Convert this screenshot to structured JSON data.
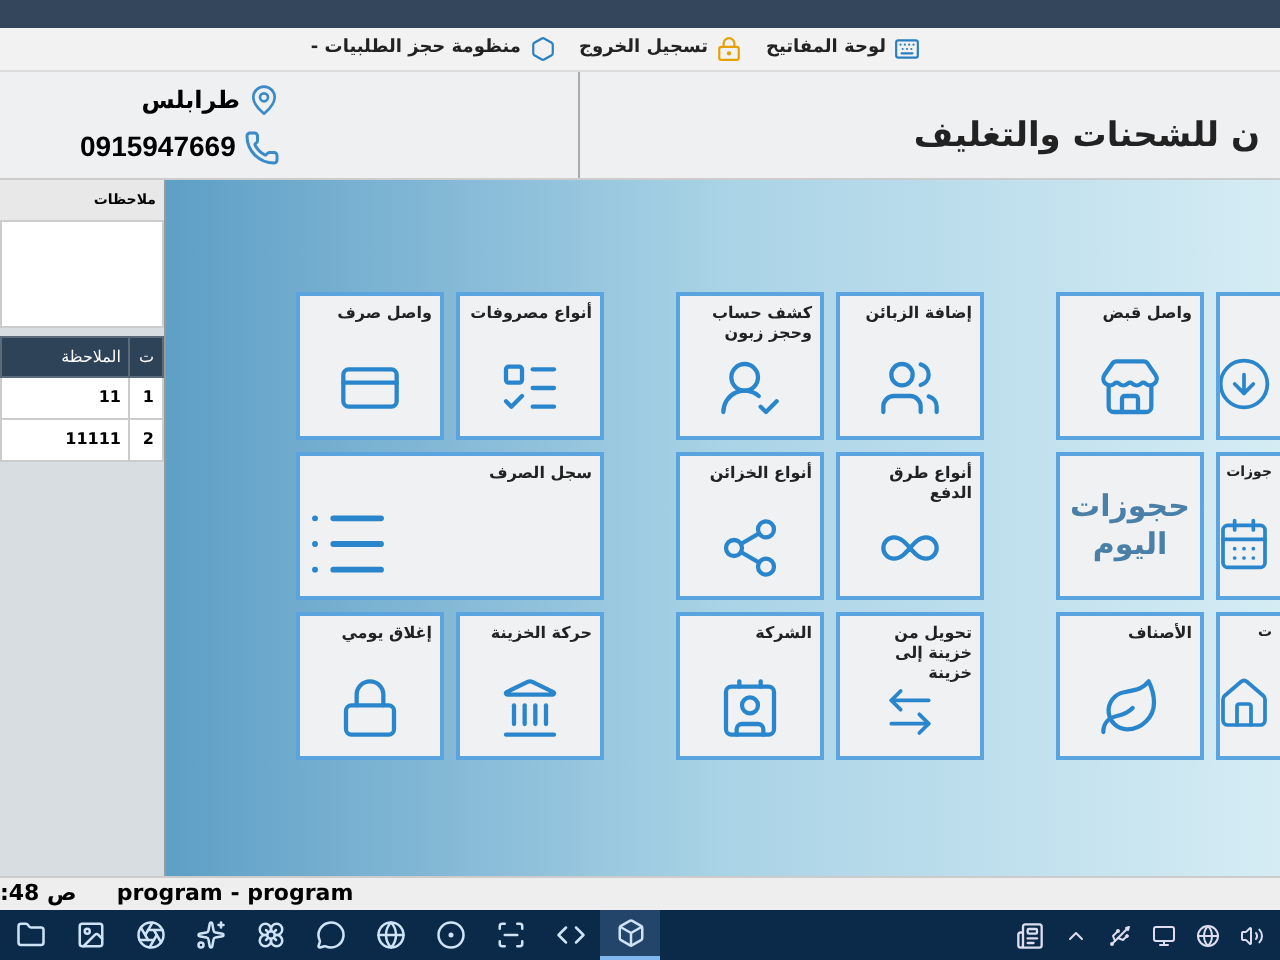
{
  "menu_bar": {
    "items": [
      {
        "label": "لوحة المفاتيح"
      },
      {
        "label": "تسجيل الخروج"
      },
      {
        "label": "منظومة حجز الطلبيات -"
      }
    ]
  },
  "header": {
    "title": "ن للشحنات والتغليف",
    "location": "طرابلس",
    "phone": "0915947669"
  },
  "notes_panel": {
    "title": "ملاحظات",
    "table": {
      "columns": [
        "ت",
        "الملاحظة"
      ],
      "rows": [
        [
          "1",
          "11"
        ],
        [
          "2",
          "11111"
        ]
      ]
    }
  },
  "tiles": [
    [
      {
        "kind": "partial"
      },
      {
        "kind": "icon",
        "label": "واصل قبض"
      },
      {
        "kind": "icon",
        "label": "إضافة الزبائن"
      },
      {
        "kind": "icon",
        "label": "كشف حساب وحجز زبون"
      },
      {
        "kind": "icon",
        "label": "أنواع مصروفات"
      },
      {
        "kind": "icon",
        "label": "واصل صرف"
      }
    ],
    [
      {
        "kind": "partial",
        "label": "جوزات"
      },
      {
        "kind": "big_text",
        "label": "حجوزات اليوم"
      },
      {
        "kind": "icon",
        "label": "أنواع طرق الدفع"
      },
      {
        "kind": "icon",
        "label": "أنواع الخزائن"
      },
      {
        "kind": "wide",
        "label": "سجل الصرف"
      }
    ],
    [
      {
        "kind": "partial",
        "label": "ت"
      },
      {
        "kind": "icon",
        "label": "الأصناف"
      },
      {
        "kind": "icon",
        "label": "تحويل من خزينة إلى خزينة"
      },
      {
        "kind": "icon",
        "label": "الشركة"
      },
      {
        "kind": "icon",
        "label": "حركة الخزينة"
      },
      {
        "kind": "icon",
        "label": "إغلاق يومي"
      }
    ]
  ],
  "status_bar": {
    "time": ":48 ص",
    "title": "program - program"
  },
  "taskbar_apps": [
    {
      "selected": false
    },
    {
      "selected": false
    },
    {
      "selected": false
    },
    {
      "selected": false
    },
    {
      "selected": false
    },
    {
      "selected": false
    },
    {
      "selected": false
    },
    {
      "selected": false
    },
    {
      "selected": false
    },
    {
      "selected": false
    },
    {
      "selected": true
    }
  ]
}
